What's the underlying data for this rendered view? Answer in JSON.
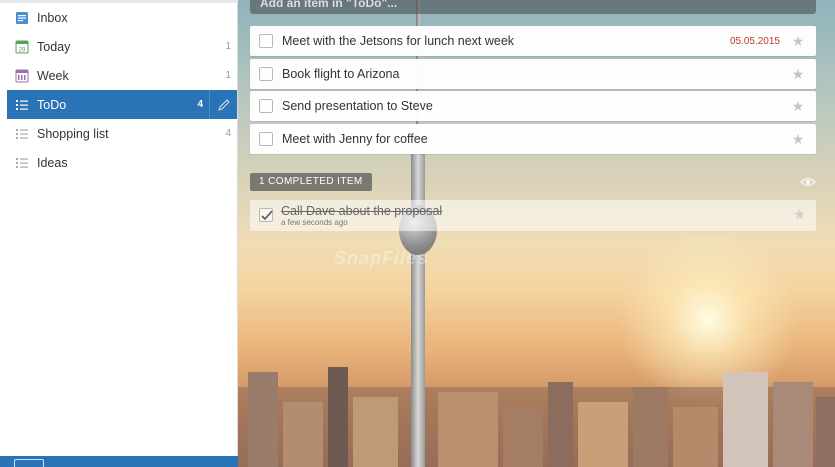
{
  "sidebar": {
    "items": [
      {
        "label": "Inbox",
        "count": "",
        "icon": "inbox-icon"
      },
      {
        "label": "Today",
        "count": "1",
        "icon": "calendar-today-icon"
      },
      {
        "label": "Week",
        "count": "1",
        "icon": "calendar-week-icon"
      },
      {
        "label": "ToDo",
        "count": "4",
        "icon": "list-icon",
        "active": true
      },
      {
        "label": "Shopping list",
        "count": "4",
        "icon": "list-icon"
      },
      {
        "label": "Ideas",
        "count": "",
        "icon": "list-icon"
      }
    ],
    "today_icon_text": "29"
  },
  "main": {
    "add_placeholder": "Add an item in \"ToDo\"...",
    "tasks": [
      {
        "title": "Meet with the Jetsons for lunch next week",
        "due": "05.05.2015"
      },
      {
        "title": "Book flight to Arizona",
        "due": ""
      },
      {
        "title": "Send presentation to Steve",
        "due": ""
      },
      {
        "title": "Meet with Jenny for coffee",
        "due": ""
      }
    ],
    "completed_label": "1 COMPLETED ITEM",
    "completed_task": {
      "title": "Call Dave about the proposal",
      "subtitle": "a few seconds ago"
    },
    "watermark": "SnapFiles"
  },
  "colors": {
    "accent": "#2b73b7",
    "due_date": "#c0392b"
  }
}
